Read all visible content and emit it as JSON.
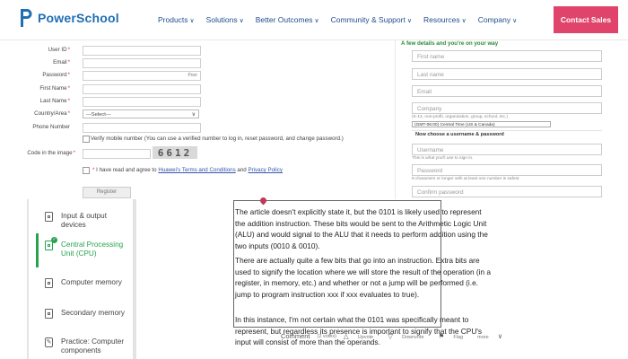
{
  "header": {
    "brand": "PowerSchool",
    "nav": [
      "Products",
      "Solutions",
      "Better Outcomes",
      "Community & Support",
      "Resources",
      "Company"
    ],
    "chevron": "∨",
    "cta": "Contact Sales",
    "brand_color": "#1f6fb3",
    "cta_color": "#e0446a"
  },
  "form": {
    "user_id": "User ID",
    "email": "Email",
    "password": "Password",
    "password_hint": "Poor",
    "first_name": "First Name",
    "last_name": "Last Name",
    "country": "Country/Area",
    "country_value": "---Select---",
    "phone": "Phone Number",
    "verify_text": "Verify mobile number (You can use a verified number to log in, reset password, and change password.)",
    "code_label": "Code in the image",
    "captcha": "6612",
    "agree_prefix": "I have read and agree to",
    "terms_link": "Huawei's Terms and Conditions",
    "agree_and": "and",
    "privacy_link": "Privacy Policy",
    "register": "Register",
    "required_mark": "*"
  },
  "signup": {
    "title": "A few details and you're on your way",
    "first_name": "First name",
    "last_name": "Last name",
    "email": "Email",
    "company": "Company",
    "company_hint": "(K-12, non-profit, organization, group, school, etc.)",
    "timezone": "(GMT-06:00) Central Time (US & Canada)",
    "subhead": "Now choose a username & password",
    "username": "Username",
    "username_hint": "This is what you'll use to sign in.",
    "password": "Password",
    "password_hint": "8 characters or longer with at least one number is safest.",
    "confirm": "Confirm password",
    "title_color": "#2f8a3a"
  },
  "course": {
    "items": [
      {
        "label": "Input & output devices",
        "icon": "page-icon"
      },
      {
        "label": "Central Processing Unit (CPU)",
        "icon": "page-icon",
        "active": true
      },
      {
        "label": "Computer memory",
        "icon": "page-icon"
      },
      {
        "label": "Secondary memory",
        "icon": "page-icon"
      },
      {
        "label": "Practice: Computer components",
        "icon": "wrench-icon"
      }
    ],
    "active_color": "#27a350",
    "check": "✓"
  },
  "answer": {
    "p1": "The article doesn't explicitly state it, but the 0101 is likely used to represent the addition instruction. These bits would be sent to the Arithmetic Logic Unit (ALU) and would signal to the ALU that it needs to perform addition using the two inputs (0010 & 0010).",
    "p2": "There are actually quite a few bits that go into an instruction. Extra bits are used to signify the location where we will store the result of the operation (in a register, in memory, etc.) and whether or not a jump will be performed (i.e. jump to program instruction xxx if xxx evaluates to true).",
    "p3": "In this instance, I'm not certain what the 0101 was specifically meant to represent, but regardless its presence is important to signify that the CPU's input will consist of more than the operands.",
    "comment": "Comment",
    "votes": "(2 votes)",
    "upvote": "Upvote",
    "downvote": "Downvote",
    "flag": "Flag",
    "more": "more"
  }
}
